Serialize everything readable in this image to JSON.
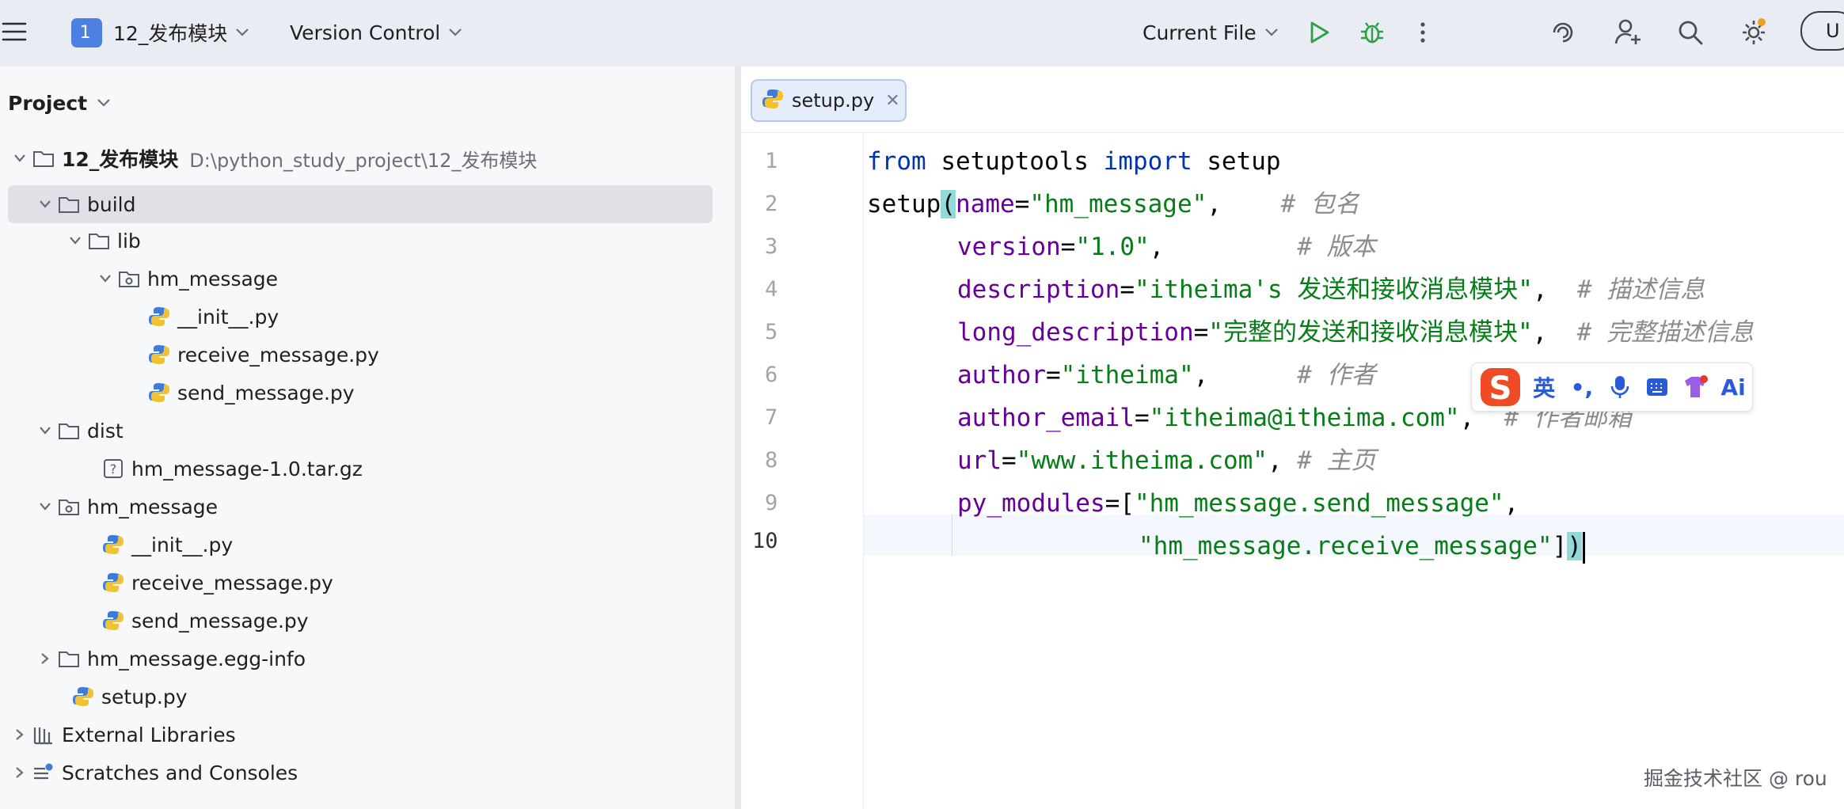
{
  "toolbar": {
    "project_badge": "1 ",
    "project_name": "12_发布模块",
    "vcs_label": "Version Control",
    "run_config": "Current File",
    "update_label": "U"
  },
  "project_panel": {
    "title": "Project",
    "tree": [
      {
        "label": "12_发布模块",
        "hint": "D:\\python_study_project\\12_发布模块"
      },
      {
        "label": "build"
      },
      {
        "label": "lib"
      },
      {
        "label": "hm_message"
      },
      {
        "label": "__init__.py"
      },
      {
        "label": "receive_message.py"
      },
      {
        "label": "send_message.py"
      },
      {
        "label": "dist"
      },
      {
        "label": "hm_message-1.0.tar.gz"
      },
      {
        "label": "hm_message"
      },
      {
        "label": "__init__.py"
      },
      {
        "label": "receive_message.py"
      },
      {
        "label": "send_message.py"
      },
      {
        "label": "hm_message.egg-info"
      },
      {
        "label": "setup.py"
      },
      {
        "label": "External Libraries"
      },
      {
        "label": "Scratches and Consoles"
      }
    ]
  },
  "editor": {
    "tab_label": "setup.py",
    "line_numbers": [
      "1",
      "2",
      "3",
      "4",
      "5",
      "6",
      "7",
      "8",
      "9",
      "10"
    ],
    "code": {
      "l1": {
        "kw1": "from",
        "t1": " setuptools ",
        "kw2": "import",
        "t2": " setup"
      },
      "l2": {
        "fn": "setup",
        "paren": "(",
        "p": "name",
        "eq": "=",
        "s": "\"hm_message\"",
        "comma": ",",
        "c": "# 包名"
      },
      "l3": {
        "p": "version",
        "eq": "=",
        "s": "\"1.0\"",
        "comma": ",",
        "c": "# 版本"
      },
      "l4": {
        "p": "description",
        "eq": "=",
        "s": "\"itheima's 发送和接收消息模块\"",
        "comma": ",",
        "c": "# 描述信息"
      },
      "l5": {
        "p": "long_description",
        "eq": "=",
        "s": "\"完整的发送和接收消息模块\"",
        "comma": ",",
        "c": "# 完整描述信息"
      },
      "l6": {
        "p": "author",
        "eq": "=",
        "s": "\"itheima\"",
        "comma": ",",
        "c": "# 作者"
      },
      "l7": {
        "p": "author_email",
        "eq": "=",
        "s": "\"itheima@itheima.com\"",
        "comma": ",",
        "c": "# 作者邮箱"
      },
      "l8": {
        "p": "url",
        "eq": "=",
        "s": "\"www.itheima.com\"",
        "comma": ",",
        "c": "# 主页"
      },
      "l9": {
        "p": "py_modules",
        "eq": "=",
        "br": "[",
        "s": "\"hm_message.send_message\"",
        "comma": ","
      },
      "l10": {
        "s": "\"hm_message.receive_message\"",
        "br": "]",
        "paren": ")"
      }
    }
  },
  "ime": {
    "mode": "英",
    "punct": "•,",
    "ai": "Ai"
  },
  "watermark": "掘金技术社区 @ rou",
  "colors": {
    "keyword": "#0033b3",
    "parameter": "#660099",
    "string": "#067d17",
    "comment": "#8c8c8c",
    "accent": "#4b7fe0"
  }
}
